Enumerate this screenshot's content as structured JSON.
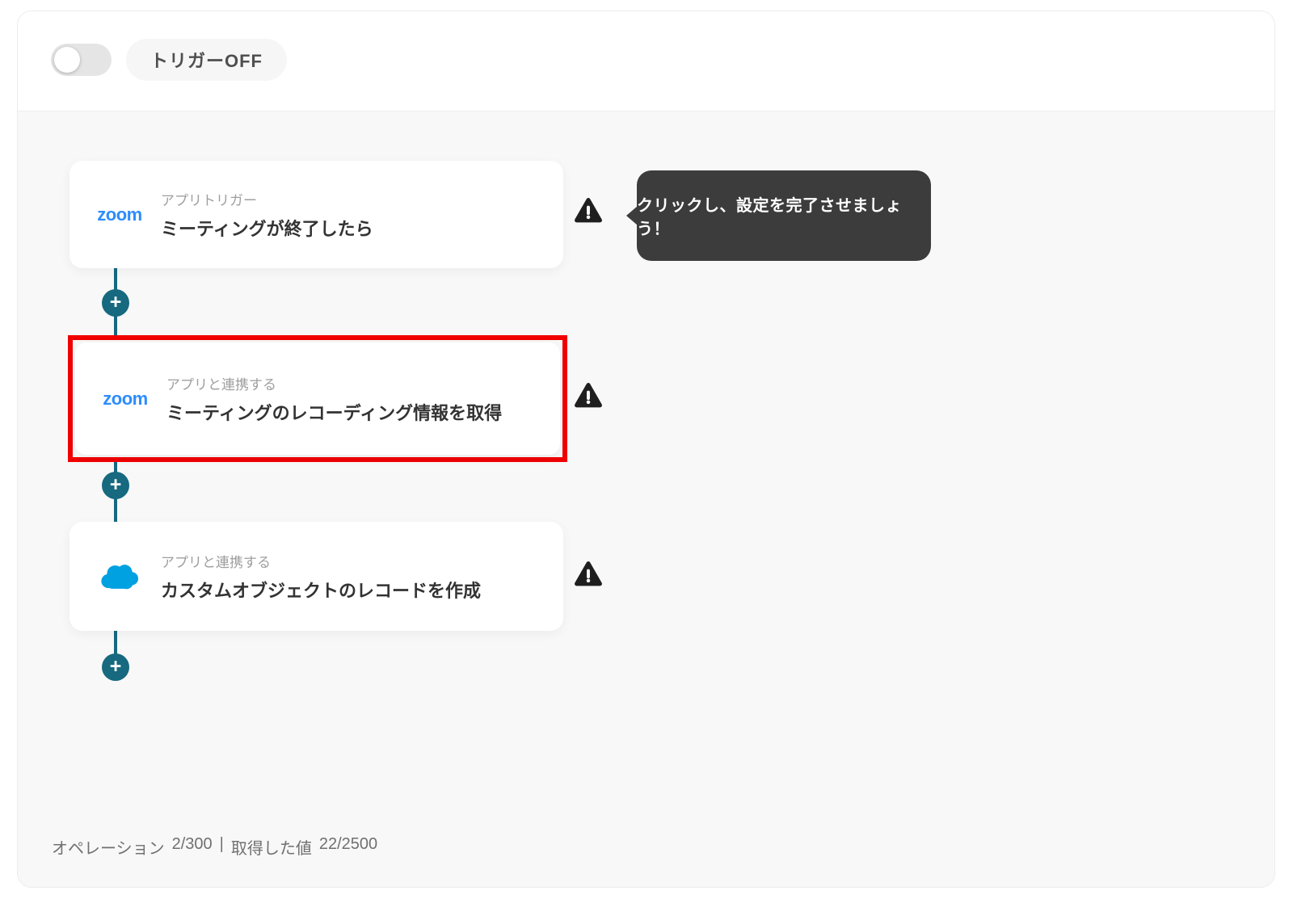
{
  "header": {
    "toggle_state": "off",
    "trigger_label": "トリガーOFF"
  },
  "workflow": {
    "tooltip_text": "クリックし、設定を完了させましょう！",
    "add_glyph": "+",
    "cards": [
      {
        "app": "zoom",
        "app_text": "zoom",
        "type_label": "アプリトリガー",
        "title": "ミーティングが終了したら",
        "warning": true,
        "highlighted": false
      },
      {
        "app": "zoom",
        "app_text": "zoom",
        "type_label": "アプリと連携する",
        "title": "ミーティングのレコーディング情報を取得",
        "warning": true,
        "highlighted": true
      },
      {
        "app": "salesforce",
        "app_text": "",
        "type_label": "アプリと連携する",
        "title": "カスタムオブジェクトのレコードを作成",
        "warning": true,
        "highlighted": false
      }
    ]
  },
  "status_bar": {
    "operations_label": "オペレーション",
    "operations_value": "2/300",
    "separator": "|",
    "acquired_label": "取得した値",
    "acquired_value": "22/2500"
  },
  "colors": {
    "accent_teal": "#16697F",
    "highlight_red": "#F00000",
    "zoom_blue": "#2D8CFF",
    "salesforce_blue": "#00A1E0",
    "tooltip_bg": "#3C3C3C",
    "warning_black": "#1F1F1F",
    "canvas_bg": "#F8F8F8"
  }
}
